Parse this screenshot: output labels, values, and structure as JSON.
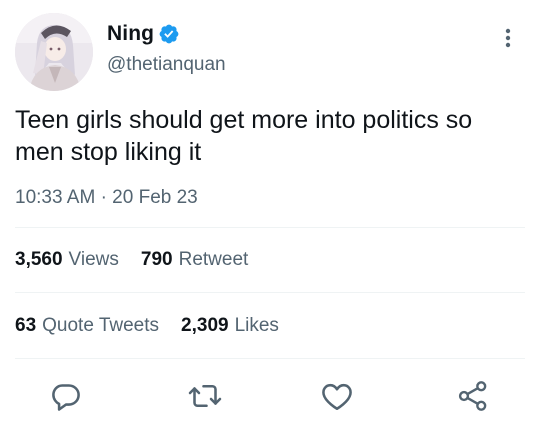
{
  "user": {
    "display_name": "Ning",
    "handle": "@thetianquan",
    "verified_icon": "verified-badge-icon",
    "avatar": "anime-character-avatar"
  },
  "tweet": {
    "text": "Teen girls should get more into politics so men stop liking it",
    "time": "10:33 AM",
    "separator": "·",
    "date": "20 Feb 23"
  },
  "stats": {
    "views_count": "3,560",
    "views_label": "Views",
    "retweets_count": "790",
    "retweets_label": "Retweet",
    "quotes_count": "63",
    "quotes_label": "Quote Tweets",
    "likes_count": "2,309",
    "likes_label": "Likes"
  },
  "actions": [
    "reply-icon",
    "retweet-icon",
    "like-icon",
    "share-icon"
  ],
  "colors": {
    "text": "#0f1419",
    "secondary": "#536471",
    "verified": "#1d9bf0",
    "divider": "#eff3f4"
  }
}
